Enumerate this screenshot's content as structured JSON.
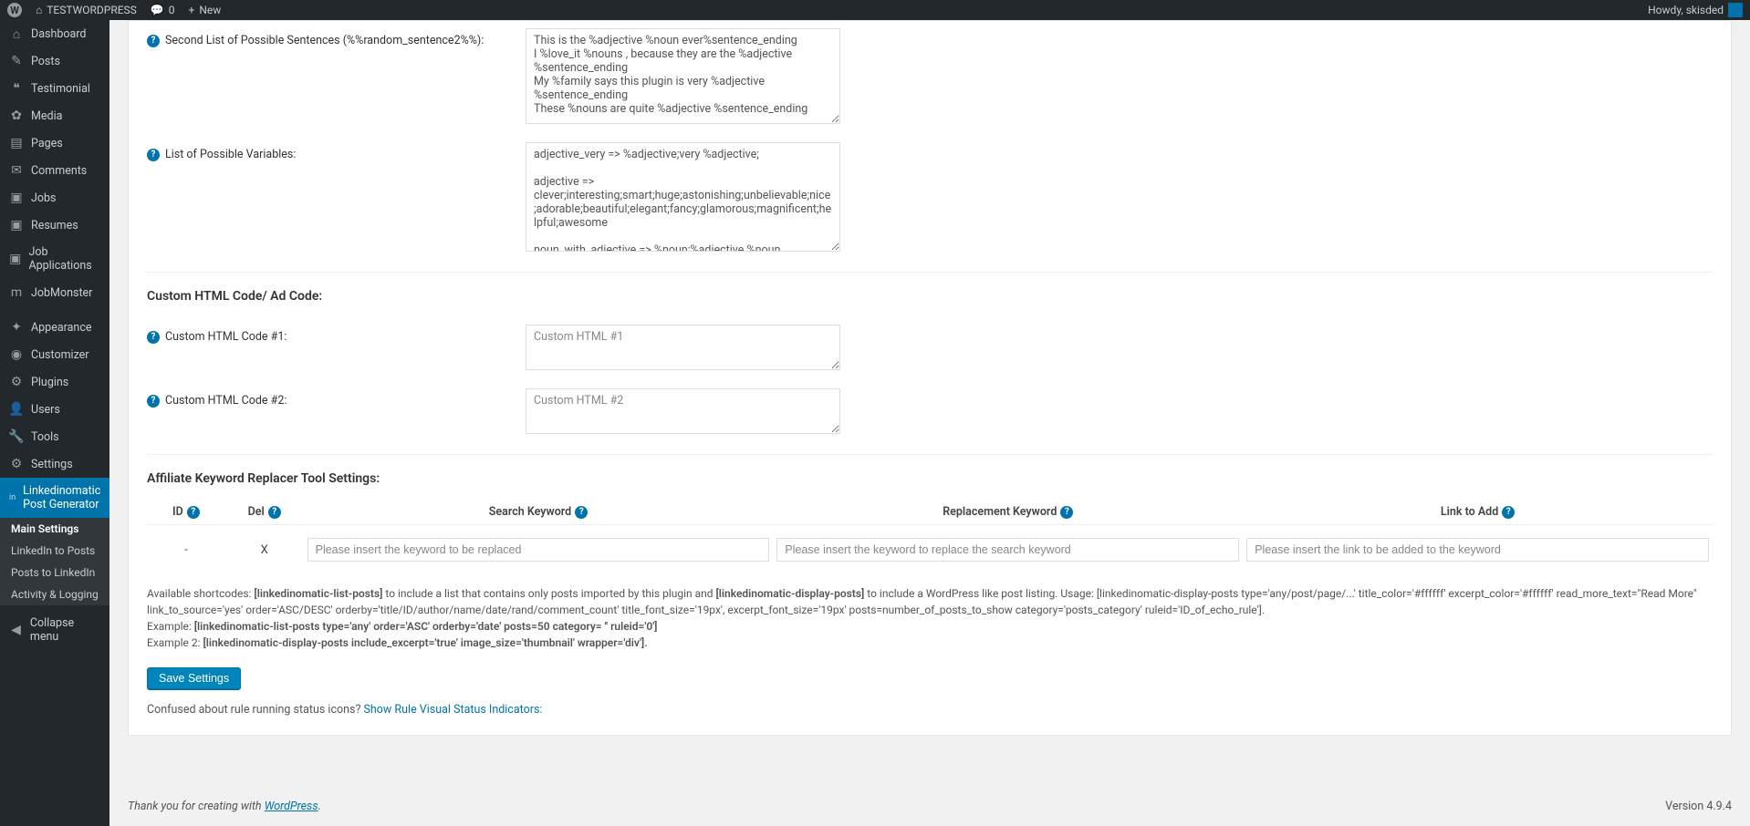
{
  "adminbar": {
    "site_name": "TESTWORDPRESS",
    "comments_count": "0",
    "new_label": "New",
    "howdy": "Howdy, skisded"
  },
  "sidebar": {
    "items": [
      {
        "icon": "⌂",
        "label": "Dashboard"
      },
      {
        "icon": "✎",
        "label": "Posts"
      },
      {
        "icon": "❝",
        "label": "Testimonial"
      },
      {
        "icon": "✿",
        "label": "Media"
      },
      {
        "icon": "▤",
        "label": "Pages"
      },
      {
        "icon": "✉",
        "label": "Comments"
      },
      {
        "icon": "▣",
        "label": "Jobs"
      },
      {
        "icon": "▣",
        "label": "Resumes"
      },
      {
        "icon": "▣",
        "label": "Job Applications"
      },
      {
        "icon": "m",
        "label": "JobMonster"
      },
      {
        "icon": "✦",
        "label": "Appearance"
      },
      {
        "icon": "◉",
        "label": "Customizer"
      },
      {
        "icon": "⚙",
        "label": "Plugins"
      },
      {
        "icon": "👤",
        "label": "Users"
      },
      {
        "icon": "🔧",
        "label": "Tools"
      },
      {
        "icon": "⚙",
        "label": "Settings"
      }
    ],
    "current": {
      "icon": "in",
      "label": "Linkedinomatic Post Generator"
    },
    "submenu": [
      "Main Settings",
      "LinkedIn to Posts",
      "Posts to LinkedIn",
      "Activity & Logging"
    ],
    "collapse_label": "Collapse menu"
  },
  "form": {
    "second_sentences": {
      "label": "Second List of Possible Sentences (%%random_sentence2%%):",
      "value": "This is the %adjective %noun ever%sentence_ending\nI %love_it %nouns , because they are the %adjective %sentence_ending\nMy %family says this plugin is very %adjective %sentence_ending\nThese %nouns are quite %adjective %sentence_ending"
    },
    "variables": {
      "label": "List of Possible Variables:",
      "value": "adjective_very => %adjective;very %adjective;\n\nadjective => clever;interesting;smart;huge;astonishing;unbelievable;nice;adorable;beautiful;elegant;fancy;glamorous;magnificent;helpful;awesome\n\nnoun_with_adjective => %noun;%adjective %noun"
    },
    "custom_html_heading": "Custom HTML Code/ Ad Code:",
    "custom_html1": {
      "label": "Custom HTML Code #1:",
      "placeholder": "Custom HTML #1"
    },
    "custom_html2": {
      "label": "Custom HTML Code #2:",
      "placeholder": "Custom HTML #2"
    },
    "affiliate_heading": "Affiliate Keyword Replacer Tool Settings:",
    "table_headers": {
      "id": "ID",
      "del": "Del",
      "search": "Search Keyword",
      "replacement": "Replacement Keyword",
      "link": "Link to Add"
    },
    "table_row": {
      "id": "-",
      "del": "X",
      "search_placeholder": "Please insert the keyword to be replaced",
      "replacement_placeholder": "Please insert the keyword to replace the search keyword",
      "link_placeholder": "Please insert the link to be added to the keyword"
    },
    "shortcodes_help": {
      "prefix": "Available shortcodes: ",
      "sc1": "[linkedinomatic-list-posts]",
      "mid1": " to include a list that contains only posts imported by this plugin and ",
      "sc2": "[linkedinomatic-display-posts]",
      "mid2": " to include a WordPress like post listing. Usage: [linkedinomatic-display-posts type='any/post/page/...' title_color='#ffffff' excerpt_color='#ffffff' read_more_text=\"Read More\" link_to_source='yes' order='ASC/DESC' orderby='title/ID/author/name/date/rand/comment_count' title_font_size='19px', excerpt_font_size='19px' posts=number_of_posts_to_show category='posts_category' ruleid='ID_of_echo_rule'].",
      "ex1_label": "Example: ",
      "ex1": "[linkedinomatic-list-posts type='any' order='ASC' orderby='date' posts=50 category= '' ruleid='0']",
      "ex2_label": "Example 2: ",
      "ex2": "[linkedinomatic-display-posts include_excerpt='true' image_size='thumbnail' wrapper='div']."
    },
    "save_button": "Save Settings",
    "confused_text": "Confused about rule running status icons? ",
    "confused_link": "Show Rule Visual Status Indicators:"
  },
  "footer": {
    "thank_prefix": "Thank you for creating with ",
    "thank_link": "WordPress",
    "thank_suffix": ".",
    "version": "Version 4.9.4"
  }
}
